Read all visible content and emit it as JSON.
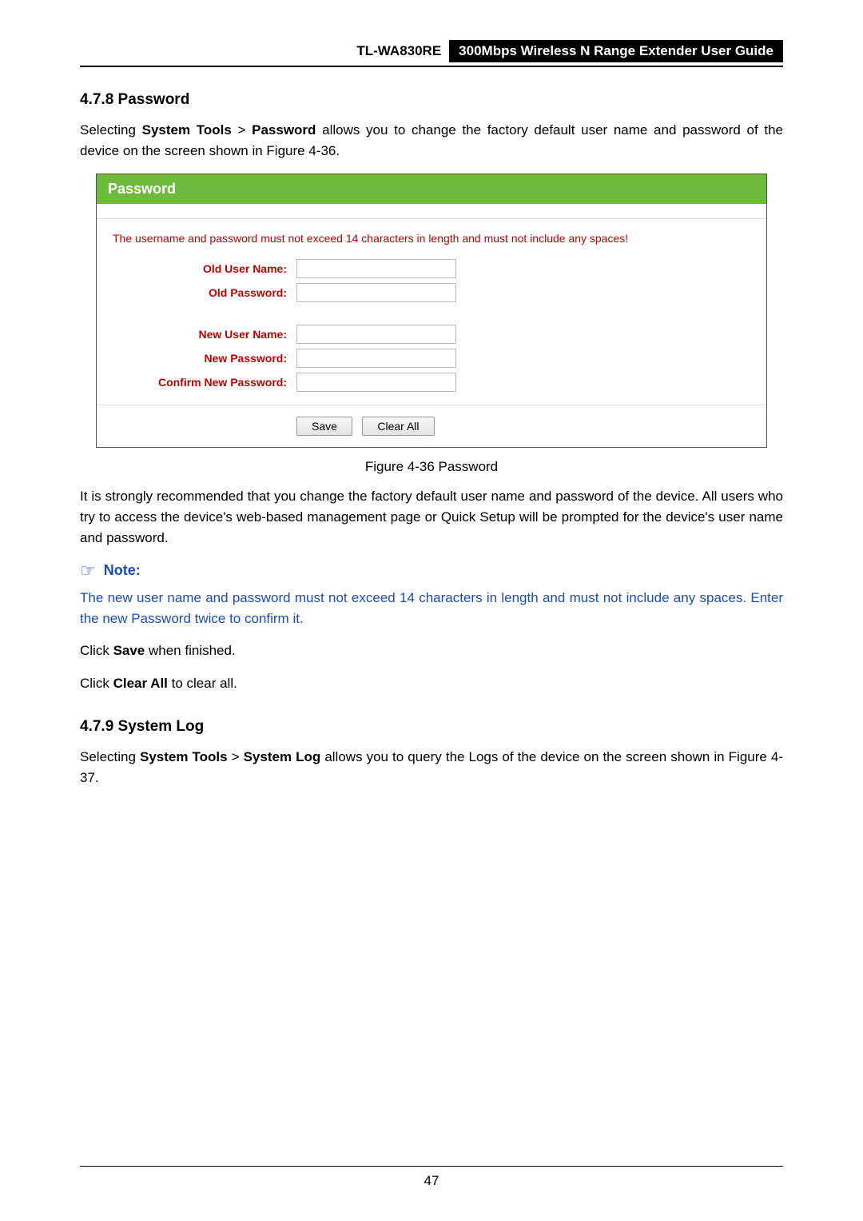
{
  "header": {
    "model": "TL-WA830RE",
    "title": "300Mbps Wireless N Range Extender User Guide"
  },
  "section1": {
    "heading": "4.7.8  Password",
    "intro_prefix": "Selecting ",
    "intro_bold1": "System Tools",
    "intro_gt": " > ",
    "intro_bold2": "Password",
    "intro_suffix": " allows you to change the factory default user name and password of the device on the screen shown in Figure 4-36."
  },
  "figure": {
    "title": "Password",
    "warning": "The username and password must not exceed 14 characters in length and must not include any spaces!",
    "labels": {
      "old_user": "Old User Name:",
      "old_pass": "Old Password:",
      "new_user": "New User Name:",
      "new_pass": "New Password:",
      "confirm_pass": "Confirm New Password:"
    },
    "buttons": {
      "save": "Save",
      "clear": "Clear All"
    },
    "caption": "Figure 4-36 Password"
  },
  "para2": "It is strongly recommended that you change the factory default user name and password of the device. All users who try to access the device's web-based management page or Quick Setup will be prompted for the device's user name and password.",
  "note": {
    "label": "Note:",
    "text": "The new user name and password must not exceed 14 characters in length and must not include any spaces. Enter the new Password twice to confirm it."
  },
  "click1_prefix": "Click ",
  "click1_bold": "Save",
  "click1_suffix": " when finished.",
  "click2_prefix": "Click ",
  "click2_bold": "Clear All",
  "click2_suffix": " to clear all.",
  "section2": {
    "heading": "4.7.9  System Log",
    "intro_prefix": "Selecting ",
    "intro_bold1": "System Tools",
    "intro_gt": " > ",
    "intro_bold2": "System Log",
    "intro_suffix": " allows you to query the Logs of the device on the screen shown in Figure 4-37."
  },
  "page_number": "47"
}
